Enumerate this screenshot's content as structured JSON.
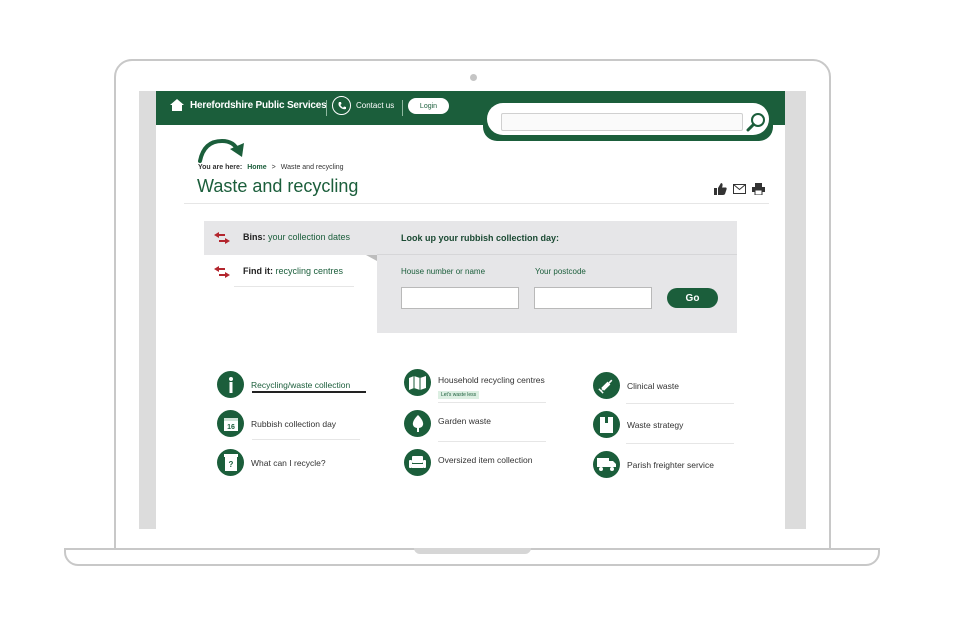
{
  "header": {
    "site_name": "Herefordshire Public Services",
    "contact_label": "Contact us",
    "login_label": "Login",
    "search_placeholder": ""
  },
  "breadcrumb": {
    "lead": "You are here:",
    "home": "Home",
    "separator": ">",
    "current": "Waste and recycling"
  },
  "page_title": "Waste and recycling",
  "tabs": [
    {
      "bold": "Bins:",
      "rest": "your collection dates"
    },
    {
      "bold": "Find it:",
      "rest": "recycling centres"
    }
  ],
  "lookup": {
    "title": "Look up your rubbish collection day:",
    "house_label": "House number or name",
    "postcode_label": "Your postcode",
    "go_label": "Go"
  },
  "links": {
    "col1": [
      {
        "label": "Recycling/waste collection",
        "icon": "info-icon"
      },
      {
        "label": "Rubbish collection day",
        "icon": "calendar-icon",
        "icon_text": "16"
      },
      {
        "label": "What can I recycle?",
        "icon": "recycle-bin-icon"
      }
    ],
    "col2": [
      {
        "label": "Household recycling centres",
        "icon": "map-icon",
        "tag": "Let's waste less"
      },
      {
        "label": "Garden waste",
        "icon": "tree-icon"
      },
      {
        "label": "Oversized item collection",
        "icon": "sofa-icon"
      }
    ],
    "col3": [
      {
        "label": "Clinical waste",
        "icon": "syringe-icon"
      },
      {
        "label": "Waste strategy",
        "icon": "document-icon"
      },
      {
        "label": "Parish freighter service",
        "icon": "truck-icon"
      }
    ]
  },
  "colors": {
    "brand": "#1b5e3b",
    "panel": "#e6e6e8",
    "accent_red": "#b3262e"
  }
}
